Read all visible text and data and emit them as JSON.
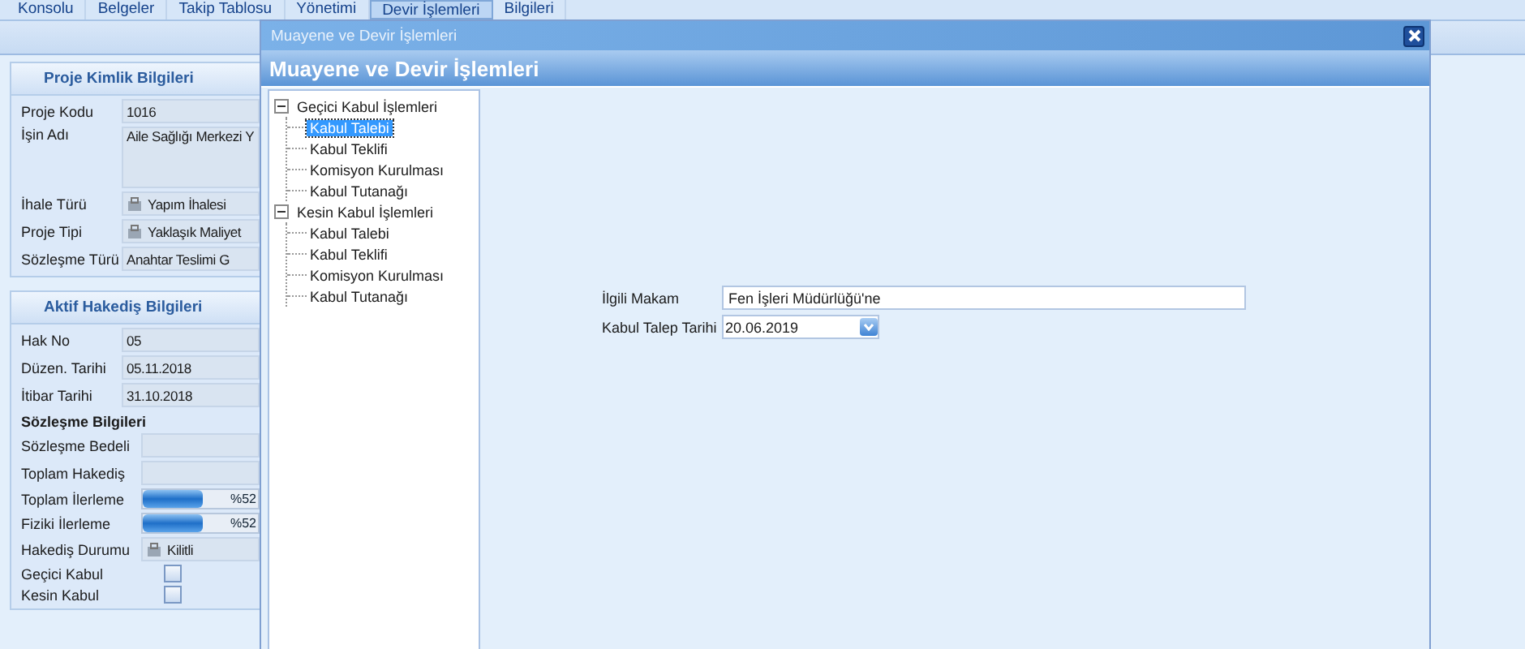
{
  "tabs": [
    {
      "label": "Konsolu",
      "selected": false
    },
    {
      "label": "Belgeler",
      "selected": false
    },
    {
      "label": "Takip Tablosu",
      "selected": false
    },
    {
      "label": "Yönetimi",
      "selected": false
    },
    {
      "label": "Devir İşlemleri",
      "selected": true
    },
    {
      "label": "Bilgileri",
      "selected": false
    }
  ],
  "project_panel": {
    "title": "Proje Kimlik Bilgileri",
    "fields": [
      {
        "kind": "text",
        "label": "Proje Kodu",
        "value": "1016"
      },
      {
        "kind": "memo",
        "label": "İşin Adı",
        "value": "Aile Sağlığı Merkezi Y"
      },
      {
        "kind": "icon",
        "label": "İhale Türü",
        "value": "Yapım İhalesi"
      },
      {
        "kind": "icon",
        "label": "Proje Tipi",
        "value": "Yaklaşık Maliyet"
      },
      {
        "kind": "text",
        "label": "Sözleşme Türü",
        "value": "Anahtar Teslimi G"
      }
    ]
  },
  "progress_panel": {
    "title": "Aktif Hakediş Bilgileri",
    "fields": [
      {
        "kind": "text",
        "label": "Hak No",
        "value": "05"
      },
      {
        "kind": "text",
        "label": "Düzen. Tarihi",
        "value": "05.11.2018"
      },
      {
        "kind": "text",
        "label": "İtibar Tarihi",
        "value": "31.10.2018"
      }
    ],
    "subtitle": "Sözleşme Bilgileri",
    "contract_fields": [
      {
        "kind": "text",
        "label": "Sözleşme Bedeli"
      },
      {
        "kind": "text",
        "label": "Toplam Hakediş"
      },
      {
        "kind": "progress",
        "label": "Toplam İlerleme",
        "level": 0.52,
        "reading": "%52"
      },
      {
        "kind": "progress",
        "label": "Fiziki İlerleme",
        "level": 0.52,
        "reading": "%52"
      },
      {
        "kind": "icon",
        "label": "Hakediş Durumu",
        "value": "Kilitli"
      },
      {
        "kind": "check",
        "label": "Geçici Kabul",
        "checked": false
      },
      {
        "kind": "check",
        "label": "Kesin Kabul",
        "checked": false
      }
    ]
  },
  "dialog": {
    "title": "Muayene ve Devir İşlemleri",
    "header": "Muayene ve Devir İşlemleri",
    "tree": [
      {
        "label": "Geçici Kabul İşlemleri",
        "expanded": true,
        "selected": false,
        "children": [
          {
            "label": "Kabul Talebi",
            "selected": true
          },
          {
            "label": "Kabul Teklifi",
            "selected": false
          },
          {
            "label": "Komisyon Kurulması",
            "selected": false
          },
          {
            "label": "Kabul Tutanağı",
            "selected": false
          }
        ]
      },
      {
        "label": "Kesin Kabul İşlemleri",
        "expanded": true,
        "selected": false,
        "children": [
          {
            "label": "Kabul Talebi",
            "selected": false
          },
          {
            "label": "Kabul Teklifi",
            "selected": false
          },
          {
            "label": "Komisyon Kurulması",
            "selected": false
          },
          {
            "label": "Kabul Tutanağı",
            "selected": false
          }
        ]
      }
    ],
    "form": [
      {
        "kind": "text",
        "label": "İlgili Makam",
        "value": "Fen İşleri Müdürlüğü'ne"
      },
      {
        "kind": "date",
        "label": "Kabul Talep Tarihi",
        "value": "20.06.2019"
      }
    ]
  }
}
